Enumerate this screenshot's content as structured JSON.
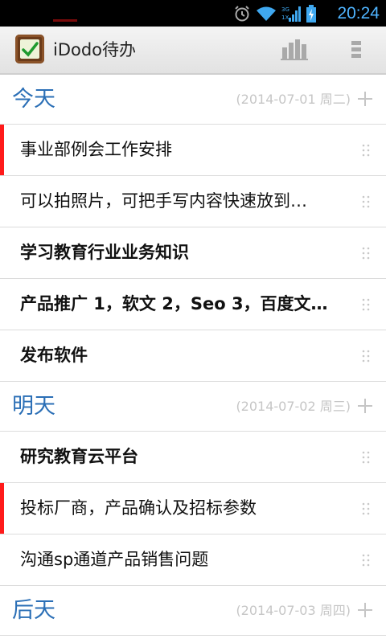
{
  "status_bar": {
    "time": "20:24",
    "icons": [
      "alarm-icon",
      "wifi-icon",
      "signal-3g-icon",
      "battery-icon"
    ],
    "time_color": "#4fb4ff"
  },
  "action_bar": {
    "title": "iDodo待办",
    "app_icon": "checkbox-icon",
    "buttons": [
      "bar-chart-icon",
      "overflow-menu-icon"
    ]
  },
  "sections": [
    {
      "title": "今天",
      "date": "(2014-07-01 周二)",
      "tasks": [
        {
          "text": "事业部例会工作安排",
          "bold": false,
          "priority": true
        },
        {
          "text": "可以拍照片，可把手写内容快速放到…",
          "bold": false,
          "priority": false
        },
        {
          "text": "学习教育行业业务知识",
          "bold": true,
          "priority": false
        },
        {
          "text": "产品推广 1，软文 2，Seo 3，百度文…",
          "bold": true,
          "priority": false
        },
        {
          "text": "发布软件",
          "bold": true,
          "priority": false
        }
      ]
    },
    {
      "title": "明天",
      "date": "(2014-07-02 周三)",
      "tasks": [
        {
          "text": "研究教育云平台",
          "bold": true,
          "priority": false
        },
        {
          "text": "投标厂商，产品确认及招标参数",
          "bold": false,
          "priority": true
        },
        {
          "text": "沟通sp通道产品销售问题",
          "bold": false,
          "priority": false
        }
      ]
    },
    {
      "title": "后天",
      "date": "(2014-07-03 周四)",
      "tasks": []
    }
  ],
  "colors": {
    "section_title": "#2b6fb6",
    "priority": "#ff1a1a",
    "date_text": "#c6c6c6"
  }
}
